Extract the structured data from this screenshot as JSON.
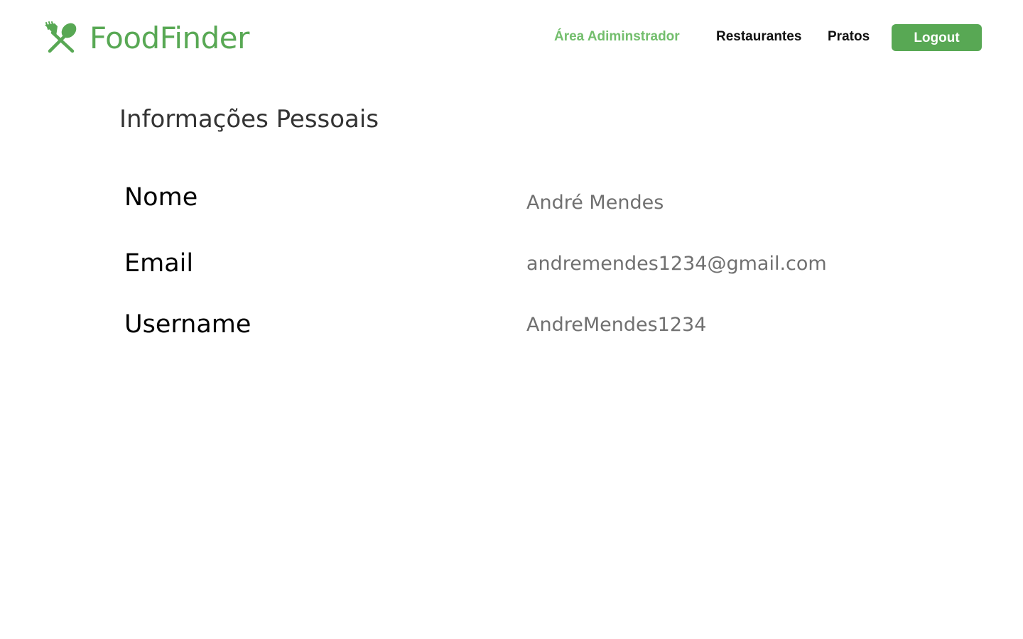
{
  "header": {
    "brand": {
      "name": "FoodFinder",
      "icon": "fork-spoon-crossed-icon"
    },
    "nav": {
      "admin": "Área Adiminstrador",
      "restaurantes": "Restaurantes",
      "pratos": "Pratos",
      "logout": "Logout"
    }
  },
  "main": {
    "title": "Informações Pessoais",
    "fields": [
      {
        "label": "Nome",
        "value": "André Mendes"
      },
      {
        "label": "Email",
        "value": "andremendes1234@gmail.com"
      },
      {
        "label": "Username",
        "value": "AndreMendes1234"
      }
    ]
  },
  "colors": {
    "brand_green": "#58a854",
    "active_nav_green": "#73be6d",
    "value_gray": "#707070",
    "title_gray": "#333333"
  }
}
